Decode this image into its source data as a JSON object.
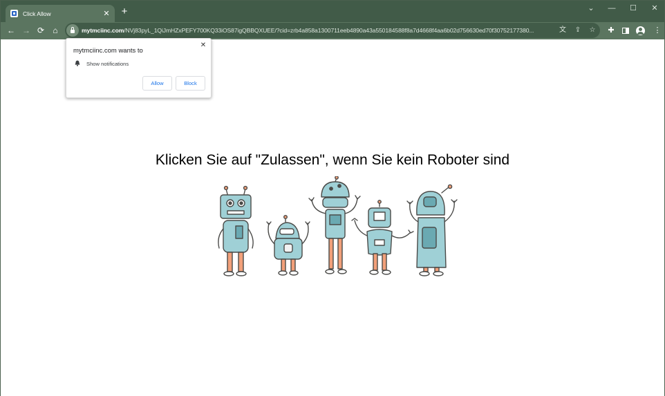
{
  "tab": {
    "title": "Click Allow",
    "favicon": "page-favicon"
  },
  "window_controls": {
    "chevron": "⌄",
    "minimize": "—",
    "maximize": "☐",
    "close": "✕"
  },
  "toolbar": {
    "back": "←",
    "forward": "→",
    "reload": "⟳",
    "home": "⌂",
    "extensions": "✚",
    "menu": "⋮"
  },
  "omnibox": {
    "domain": "mytmciinc.com",
    "path": "/NVj83pyL_1QiJmHZxPEFY700KQ33iOS87igQBBQXUEE/?cid=zrb4a858a1300711eeb4890a43a550184588f8a7d4668f4aa6b02d756630ed70f30752177380...",
    "translate": "文",
    "share": "⇪",
    "star": "☆"
  },
  "popup": {
    "title": "mytmciinc.com wants to",
    "permission": "Show notifications",
    "close": "✕",
    "allow_label": "Allow",
    "block_label": "Block"
  },
  "page": {
    "heading": "Klicken Sie auf \"Zulassen\", wenn Sie kein Roboter sind"
  },
  "colors": {
    "frame": "#415b48",
    "toolbar": "#5b7560",
    "robot_fill": "#9fd0d6",
    "robot_outline": "#4a4a48",
    "link_blue": "#1a73e8"
  }
}
